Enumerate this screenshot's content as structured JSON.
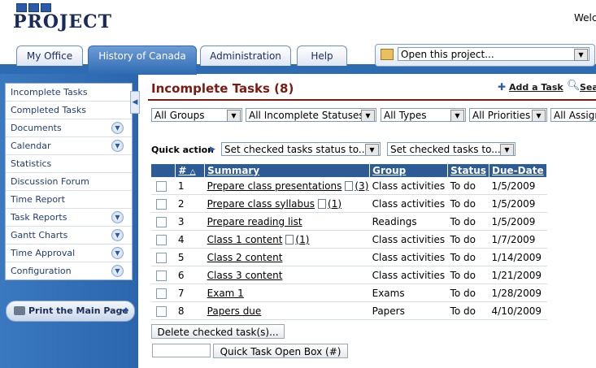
{
  "header": {
    "logo_text": "PROJECT",
    "welcome": "Welc"
  },
  "tabs": [
    "My Office",
    "History of Canada",
    "Administration",
    "Help"
  ],
  "open_project": {
    "value": "Open this project..."
  },
  "sidebar": {
    "items": [
      {
        "label": "Incomplete Tasks",
        "expandable": false
      },
      {
        "label": "Completed Tasks",
        "expandable": false
      },
      {
        "label": "Documents",
        "expandable": true
      },
      {
        "label": "Calendar",
        "expandable": true
      },
      {
        "label": "Statistics",
        "expandable": false
      },
      {
        "label": "Discussion Forum",
        "expandable": false
      },
      {
        "label": "Time Report",
        "expandable": false
      },
      {
        "label": "Task Reports",
        "expandable": true
      },
      {
        "label": "Gantt Charts",
        "expandable": true
      },
      {
        "label": "Time Approval",
        "expandable": true
      },
      {
        "label": "Configuration",
        "expandable": true
      }
    ],
    "print_label": "Print the Main Page"
  },
  "main": {
    "title": "Incomplete Tasks (8)",
    "add_task": "Add a Task",
    "search": "Sea",
    "filters": [
      "All Groups",
      "All Incomplete Statuses",
      "All Types",
      "All Priorities",
      "All Assign"
    ],
    "quick_action": {
      "label": "Quick action",
      "status_select": "Set checked tasks status to...",
      "to_select": "Set checked tasks to..."
    },
    "columns": {
      "num": "#",
      "summary": "Summary",
      "group": "Group",
      "status": "Status",
      "due": "Due-Date"
    },
    "tasks": [
      {
        "num": "1",
        "summary": "Prepare class presentations",
        "docs": "(3)",
        "group": "Class activities",
        "status": "To do",
        "due": "1/5/2009"
      },
      {
        "num": "2",
        "summary": "Prepare class syllabus",
        "docs": "(1)",
        "group": "Class activities",
        "status": "To do",
        "due": "1/5/2009"
      },
      {
        "num": "3",
        "summary": "Prepare reading list",
        "docs": "",
        "group": "Readings",
        "status": "To do",
        "due": "1/5/2009"
      },
      {
        "num": "4",
        "summary": "Class 1 content",
        "docs": "(1)",
        "group": "Class activities",
        "status": "To do",
        "due": "1/7/2009"
      },
      {
        "num": "5",
        "summary": "Class 2 content",
        "docs": "",
        "group": "Class activities",
        "status": "To do",
        "due": "1/14/2009"
      },
      {
        "num": "6",
        "summary": "Class 3 content",
        "docs": "",
        "group": "Class activities",
        "status": "To do",
        "due": "1/21/2009"
      },
      {
        "num": "7",
        "summary": "Exam 1",
        "docs": "",
        "group": "Exams",
        "status": "To do",
        "due": "1/28/2009"
      },
      {
        "num": "8",
        "summary": "Papers due",
        "docs": "",
        "group": "Papers",
        "status": "To do",
        "due": "4/10/2009"
      }
    ],
    "delete_button": "Delete checked task(s)...",
    "quick_task_button": "Quick Task Open Box (#)"
  }
}
